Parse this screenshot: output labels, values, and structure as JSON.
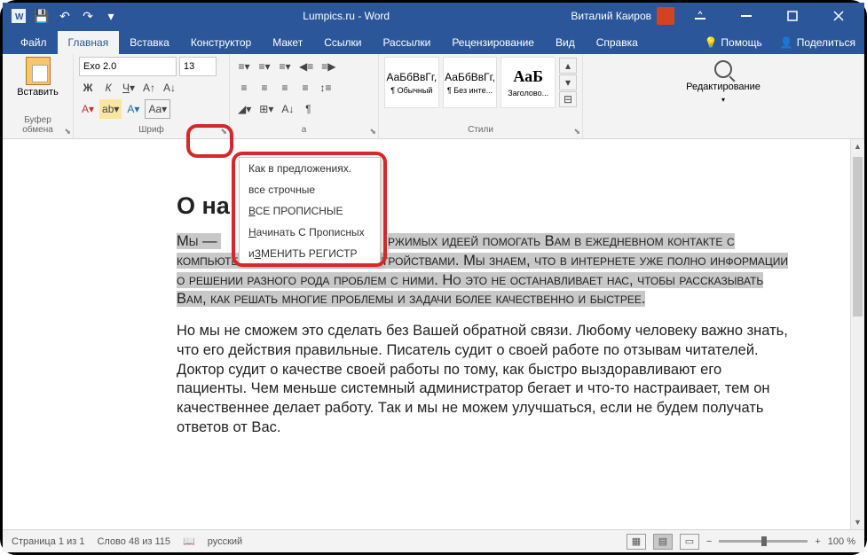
{
  "titlebar": {
    "title": "Lumpics.ru - Word",
    "user": "Виталий Каиров"
  },
  "tabs": {
    "file": "Файл",
    "home": "Главная",
    "insert": "Вставка",
    "design": "Конструктор",
    "layout": "Макет",
    "references": "Ссылки",
    "mailings": "Рассылки",
    "review": "Рецензирование",
    "view": "Вид",
    "help": "Справка",
    "tell_me": "Помощь",
    "share": "Поделиться"
  },
  "ribbon": {
    "paste": "Вставить",
    "clipboard": "Буфер обмена",
    "font_name": "Exo 2.0",
    "font_size": "13",
    "font_group": "Шриф",
    "case_btn": "Aa",
    "styles_group": "Стили",
    "style1_prev": "АаБбВвГг,",
    "style1_lbl": "¶ Обычный",
    "style2_prev": "АаБбВвГг,",
    "style2_lbl": "¶ Без инте...",
    "style3_prev": "АаБ",
    "style3_lbl": "Заголово...",
    "editing": "Редактирование"
  },
  "dropdown": {
    "i1": "Как в предложениях.",
    "i2": "все строчные",
    "i3": "ВСЕ ПРОПИСНЫЕ",
    "i4": "Начинать С Прописных",
    "i5": "иЗМЕНИТЬ РЕГИСТР"
  },
  "doc": {
    "h1": "О на",
    "p1a": "Мы — ",
    "p1b": "ржимых идеей помогать Вам в ежедневном контакте с компьютерами и мобильными устройствами. Мы знаем, что в интернете уже полно информации о решении разного рода проблем с ними. Но это не останавливает нас, чтобы рассказывать Вам, как решать многие проблемы и задачи более качественно и быстрее.",
    "p2": "Но мы не сможем это сделать без Вашей обратной связи. Любому человеку важно знать, что его действия правильные. Писатель судит о своей работе по отзывам читателей. Доктор судит о качестве своей работы по тому, как быстро выздоравливают его пациенты. Чем меньше системный администратор бегает и что-то настраивает, тем он качественнее делает работу. Так и мы не можем улучшаться, если не будем получать ответов от Вас."
  },
  "status": {
    "page": "Страница 1 из 1",
    "words": "Слово 48 из 115",
    "lang": "русский",
    "zoom": "100 %"
  }
}
